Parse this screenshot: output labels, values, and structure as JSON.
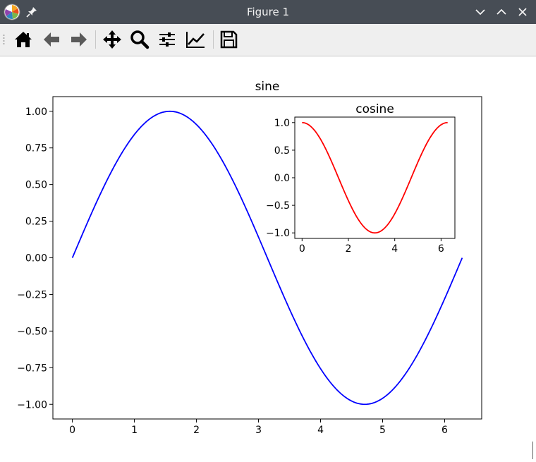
{
  "window": {
    "title": "Figure 1",
    "title_bar_color": "#474d55",
    "icons": [
      "matplotlib-app-icon",
      "pin-icon",
      "chevron-down-icon",
      "chevron-up-icon",
      "close-icon"
    ]
  },
  "toolbar": {
    "tools": [
      {
        "name": "home",
        "icon": "home-icon"
      },
      {
        "name": "back",
        "icon": "arrow-left-icon"
      },
      {
        "name": "forward",
        "icon": "arrow-right-icon"
      },
      {
        "name": "pan",
        "icon": "move-icon"
      },
      {
        "name": "zoom",
        "icon": "magnifier-icon"
      },
      {
        "name": "subplots",
        "icon": "sliders-icon"
      },
      {
        "name": "customize",
        "icon": "line-chart-icon"
      },
      {
        "name": "save",
        "icon": "floppy-disk-icon"
      }
    ]
  },
  "chart_data": [
    {
      "type": "line",
      "title": "sine",
      "xlabel": "",
      "ylabel": "",
      "function": "sin(x)",
      "x_range": [
        0,
        6.283
      ],
      "xlim": [
        -0.314,
        6.597
      ],
      "ylim": [
        -1.1,
        1.1
      ],
      "x_ticks": [
        "0",
        "1",
        "2",
        "3",
        "4",
        "5",
        "6"
      ],
      "y_ticks": [
        "1.00",
        "0.75",
        "0.50",
        "0.25",
        "0.00",
        "−0.25",
        "−0.50",
        "−0.75",
        "−1.00"
      ],
      "series": [
        {
          "color": "#0000ff",
          "x": [
            0,
            0.393,
            0.785,
            1.178,
            1.571,
            1.963,
            2.356,
            2.749,
            3.142,
            3.534,
            3.927,
            4.32,
            4.712,
            5.105,
            5.498,
            5.89,
            6.283
          ],
          "y": [
            0.0,
            0.383,
            0.707,
            0.924,
            1.0,
            0.924,
            0.707,
            0.383,
            0.0,
            -0.383,
            -0.707,
            -0.924,
            -1.0,
            -0.924,
            -0.707,
            -0.383,
            0.0
          ]
        }
      ],
      "grid": false
    },
    {
      "type": "line",
      "title": "cosine",
      "xlabel": "",
      "ylabel": "",
      "function": "cos(x)",
      "x_range": [
        0,
        6.283
      ],
      "xlim": [
        -0.314,
        6.597
      ],
      "ylim": [
        -1.1,
        1.1
      ],
      "x_ticks": [
        "0",
        "2",
        "4",
        "6"
      ],
      "y_ticks": [
        "1.0",
        "0.5",
        "0.0",
        "−0.5",
        "−1.0"
      ],
      "series": [
        {
          "color": "#ff0000",
          "x": [
            0,
            0.393,
            0.785,
            1.178,
            1.571,
            1.963,
            2.356,
            2.749,
            3.142,
            3.534,
            3.927,
            4.32,
            4.712,
            5.105,
            5.498,
            5.89,
            6.283
          ],
          "y": [
            1.0,
            0.924,
            0.707,
            0.383,
            0.0,
            -0.383,
            -0.707,
            -0.924,
            -1.0,
            -0.924,
            -0.707,
            -0.383,
            0.0,
            0.383,
            0.707,
            0.924,
            1.0
          ]
        }
      ],
      "grid": false,
      "placement": "inset-top-right"
    }
  ]
}
